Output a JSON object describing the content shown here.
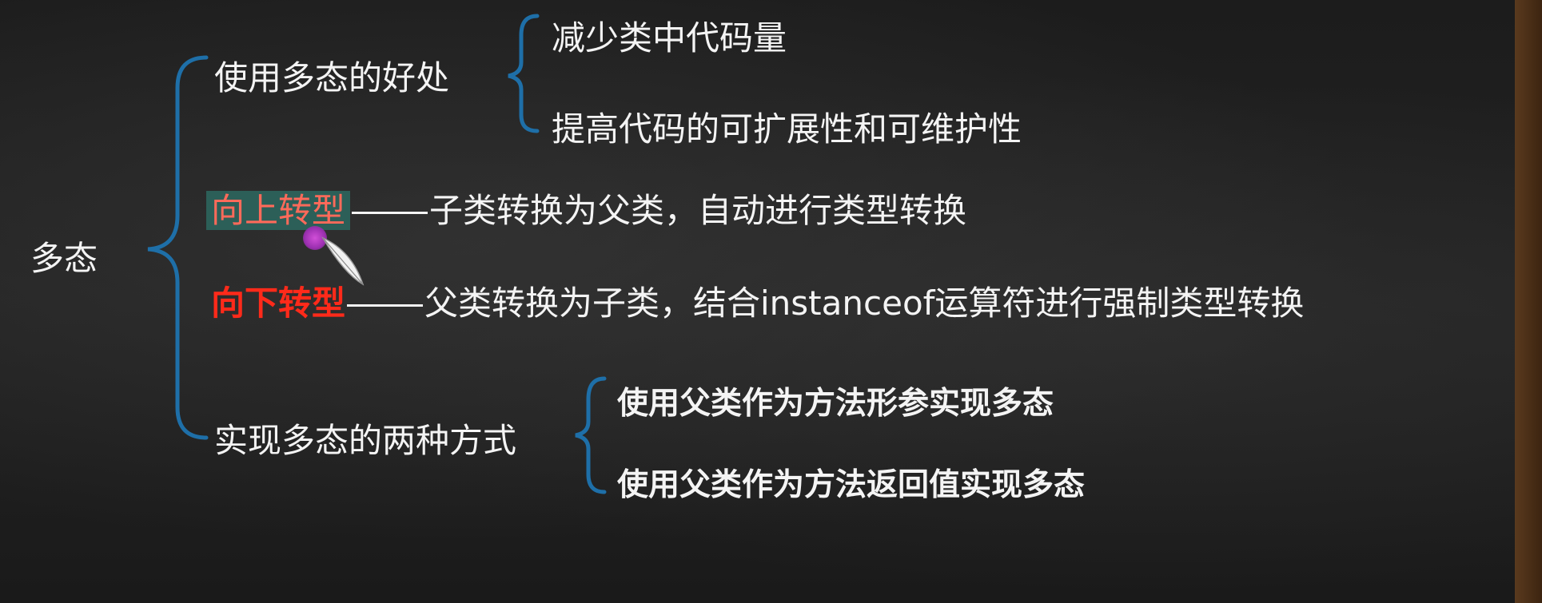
{
  "root": {
    "label": "多态"
  },
  "benefits": {
    "label": "使用多态的好处",
    "items": [
      "减少类中代码量",
      "提高代码的可扩展性和可维护性"
    ]
  },
  "upcast": {
    "term": "向上转型",
    "description": "子类转换为父类，自动进行类型转换"
  },
  "downcast": {
    "term": "向下转型",
    "description": "父类转换为子类，结合instanceof运算符进行强制类型转换"
  },
  "ways": {
    "label": "实现多态的两种方式",
    "items": [
      "使用父类作为方法形参实现多态",
      "使用父类作为方法返回值实现多态"
    ]
  }
}
